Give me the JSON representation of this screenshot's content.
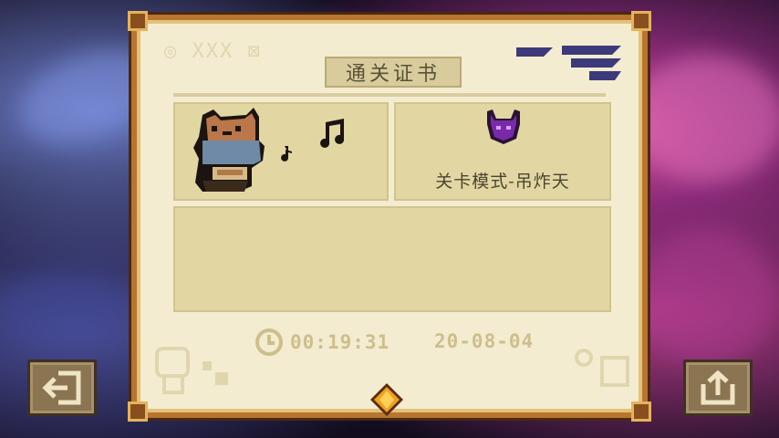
{
  "certificate": {
    "title": "通关证书",
    "mode_label": "关卡模式-吊炸天",
    "time": "00:19:31",
    "date": "20-08-04"
  },
  "icons": {
    "character": "bear-character-icon",
    "music_notes": "music-notes-icon",
    "demon_badge": "demon-helmet-icon",
    "clock": "clock-icon",
    "exit": "exit-icon",
    "share": "share-icon",
    "gem": "orange-gem-icon"
  },
  "colors": {
    "parchment": "#f3ecd0",
    "frame": "#b8752f",
    "panel": "#e2d7a2",
    "text_dark": "#4a4530",
    "text_faded": "#cdbf8c",
    "button": "#8b7452",
    "demon": "#7a2aa8"
  }
}
